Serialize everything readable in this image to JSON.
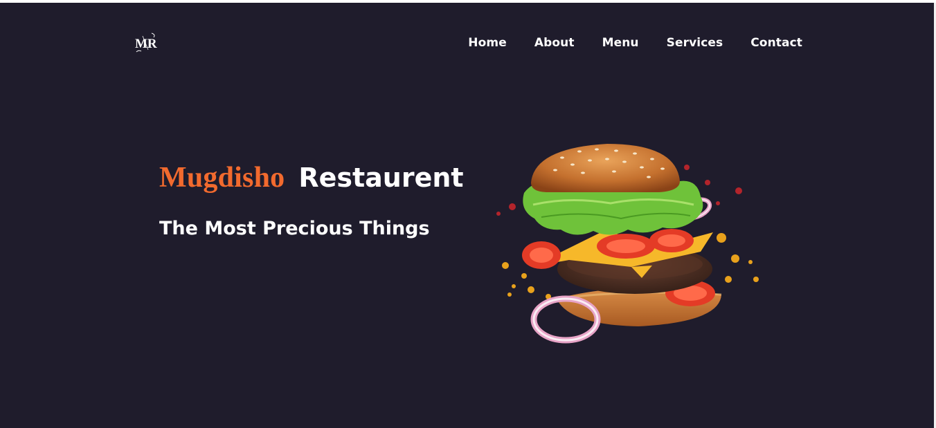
{
  "logo": {
    "text": "MR"
  },
  "nav": {
    "items": [
      {
        "label": "Home"
      },
      {
        "label": "About"
      },
      {
        "label": "Menu"
      },
      {
        "label": "Services"
      },
      {
        "label": "Contact"
      }
    ]
  },
  "hero": {
    "brand": "Mugdisho",
    "name": "Restaurent",
    "subtitle": "The Most Precious Things"
  },
  "colors": {
    "background": "#1f1c2c",
    "accent": "#f26a2e",
    "text": "#ffffff"
  },
  "icons": {
    "logo": "mr-monogram-logo",
    "hero_image": "burger-image"
  }
}
